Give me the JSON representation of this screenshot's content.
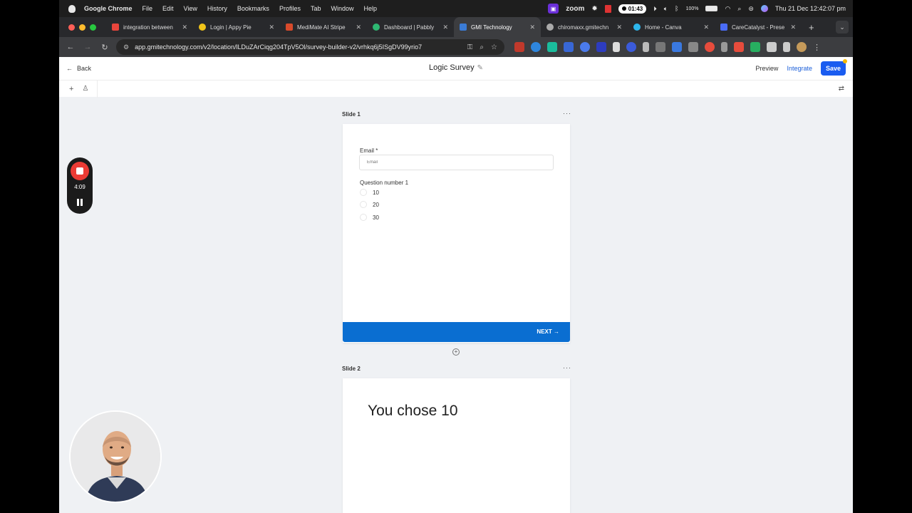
{
  "menubar": {
    "app_name": "Google Chrome",
    "items": [
      "File",
      "Edit",
      "View",
      "History",
      "Bookmarks",
      "Profiles",
      "Tab",
      "Window",
      "Help"
    ],
    "zoom_label": "zoom",
    "recording_time": "01:43",
    "battery": "100%",
    "datetime": "Thu 21 Dec  12:42:07 pm"
  },
  "tabs": [
    {
      "title": "integration between",
      "favicon_color": "#e8453c"
    },
    {
      "title": "Login | Appy Pie",
      "favicon_color": "#ffffff"
    },
    {
      "title": "MediMate AI Stripe",
      "favicon_color": "#d84a2b"
    },
    {
      "title": "Dashboard | Pabbly",
      "favicon_color": "#2eb872"
    },
    {
      "title": "GMI Technology",
      "favicon_color": "#3a7bd5",
      "active": true
    },
    {
      "title": "chiromaxx.gmitechn",
      "favicon_color": "#aaaaaa"
    },
    {
      "title": "Home - Canva",
      "favicon_color": "#2db6ec"
    },
    {
      "title": "CareCatalyst - Prese",
      "favicon_color": "#4a6cf7"
    }
  ],
  "address_bar": {
    "url": "app.gmitechnology.com/v2/location/lLDuZArCiqg204TpV5Ol/survey-builder-v2/vrhkq6j5ISgDV99yrio7"
  },
  "app": {
    "back_label": "Back",
    "survey_title": "Logic Survey",
    "preview_label": "Preview",
    "integrate_label": "Integrate",
    "save_label": "Save",
    "accent": "#1a5cf0"
  },
  "slides": [
    {
      "label": "Slide 1",
      "email_label": "Email *",
      "email_placeholder": "Email",
      "question_label": "Question number 1",
      "options": [
        "10",
        "20",
        "30"
      ],
      "next_label": "NEXT",
      "next_color": "#0a6ed1"
    },
    {
      "label": "Slide 2",
      "text": "You chose 10"
    }
  ],
  "recorder": {
    "elapsed": "4:09",
    "stop_color": "#ec3b35"
  }
}
